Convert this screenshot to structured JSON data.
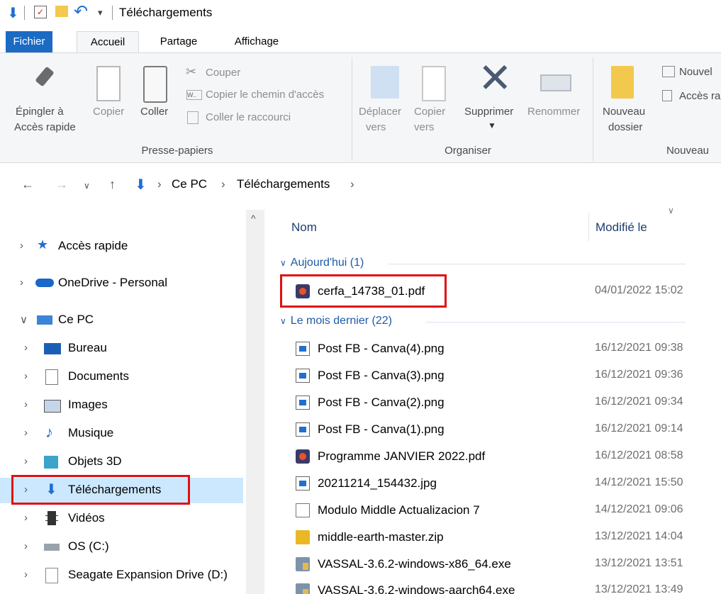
{
  "window": {
    "title": "Téléchargements"
  },
  "ribbon_tabs": [
    "Fichier",
    "Accueil",
    "Partage",
    "Affichage"
  ],
  "ribbon": {
    "pin": [
      "Épingler à",
      "Accès rapide"
    ],
    "copy": "Copier",
    "paste": "Coller",
    "cut": "Couper",
    "copy_path": "Copier le chemin d'accès",
    "paste_shortcut": "Coller le raccourci",
    "clipboard_group": "Presse-papiers",
    "move_to": [
      "Déplacer",
      "vers"
    ],
    "copy_to": [
      "Copier",
      "vers"
    ],
    "delete": "Supprimer",
    "rename": "Renommer",
    "organize_group": "Organiser",
    "new_folder": [
      "Nouveau",
      "dossier"
    ],
    "new_item": "Nouvel",
    "easy_access": "Accès ra",
    "new_group": "Nouveau"
  },
  "breadcrumb": [
    "Ce PC",
    "Téléchargements"
  ],
  "nav": [
    {
      "label": "Accès rapide",
      "icon": "star-icon"
    },
    {
      "label": "OneDrive - Personal",
      "icon": "cloud-icon"
    },
    {
      "label": "Ce PC",
      "icon": "computer-icon"
    },
    {
      "label": "Bureau",
      "icon": "desktop-icon"
    },
    {
      "label": "Documents",
      "icon": "documents-icon"
    },
    {
      "label": "Images",
      "icon": "images-icon"
    },
    {
      "label": "Musique",
      "icon": "music-icon"
    },
    {
      "label": "Objets 3D",
      "icon": "cube-icon"
    },
    {
      "label": "Téléchargements",
      "icon": "download-icon"
    },
    {
      "label": "Vidéos",
      "icon": "video-icon"
    },
    {
      "label": "OS (C:)",
      "icon": "drive-icon"
    },
    {
      "label": "Seagate Expansion Drive (D:)",
      "icon": "drive-icon"
    }
  ],
  "columns": {
    "name": "Nom",
    "modified": "Modifié le"
  },
  "groups": {
    "today": "Aujourd'hui (1)",
    "last_month": "Le mois dernier (22)"
  },
  "files_today": [
    {
      "name": "cerfa_14738_01.pdf",
      "date": "04/01/2022 15:02",
      "icon": "pdf-icon"
    }
  ],
  "files_last_month": [
    {
      "name": "Post FB - Canva(4).png",
      "date": "16/12/2021 09:38",
      "icon": "image-file-icon"
    },
    {
      "name": "Post FB - Canva(3).png",
      "date": "16/12/2021 09:36",
      "icon": "image-file-icon"
    },
    {
      "name": "Post FB - Canva(2).png",
      "date": "16/12/2021 09:34",
      "icon": "image-file-icon"
    },
    {
      "name": "Post FB - Canva(1).png",
      "date": "16/12/2021 09:14",
      "icon": "image-file-icon"
    },
    {
      "name": "Programme JANVIER 2022.pdf",
      "date": "16/12/2021 08:58",
      "icon": "pdf-icon"
    },
    {
      "name": "20211214_154432.jpg",
      "date": "14/12/2021 15:50",
      "icon": "image-file-icon"
    },
    {
      "name": "Modulo Middle Actualizacion 7",
      "date": "14/12/2021 09:06",
      "icon": "file-icon"
    },
    {
      "name": "middle-earth-master.zip",
      "date": "13/12/2021 14:04",
      "icon": "zip-icon"
    },
    {
      "name": "VASSAL-3.6.2-windows-x86_64.exe",
      "date": "13/12/2021 13:51",
      "icon": "exe-icon"
    },
    {
      "name": "VASSAL-3.6.2-windows-aarch64.exe",
      "date": "13/12/2021 13:49",
      "icon": "exe-icon"
    }
  ]
}
